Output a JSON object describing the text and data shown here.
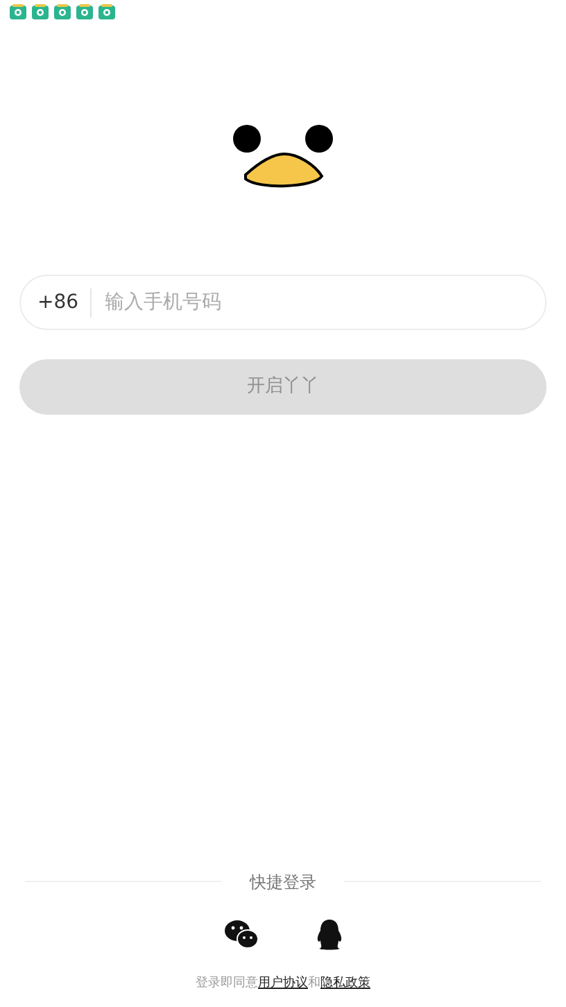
{
  "status_bar": {
    "notification_icons": [
      {
        "kind": "app"
      },
      {
        "kind": "app"
      },
      {
        "kind": "app"
      },
      {
        "kind": "app"
      },
      {
        "kind": "app"
      }
    ]
  },
  "phone_form": {
    "country_code": "+86",
    "placeholder": "输入手机号码"
  },
  "submit_button": {
    "label": "开启丫丫",
    "disabled": true
  },
  "quick_login": {
    "title": "快捷登录"
  },
  "agreement": {
    "prefix": "登录即同意",
    "link_1": "用户协议",
    "joiner": "和",
    "link_2": "隐私政策"
  }
}
